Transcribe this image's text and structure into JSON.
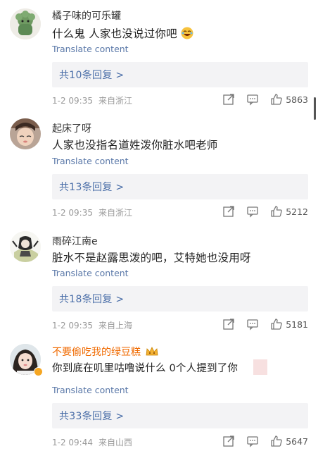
{
  "comments": [
    {
      "username": "橘子味的可乐罐",
      "text": "什么鬼 人家也没说过你吧",
      "translate": "Translate content",
      "replies": "共10条回复 >",
      "time": "1-2 09:35",
      "location": "来自浙江",
      "likes": "5863"
    },
    {
      "username": "起床了呀",
      "text": "人家也没指名道姓泼你脏水吧老师",
      "translate": "Translate content",
      "replies": "共13条回复 >",
      "time": "1-2 09:35",
      "location": "来自浙江",
      "likes": "5212"
    },
    {
      "username": "雨碎江南e",
      "text": "脏水不是赵露思泼的吧，艾特她也没用呀",
      "translate": "Translate content",
      "replies": "共18条回复 >",
      "time": "1-2 09:35",
      "location": "来自上海",
      "likes": "5181"
    },
    {
      "username": "不要偷吃我的绿豆糕",
      "text": "你到底在叽里咕噜说什么 0个人提到了你",
      "translate": "Translate content",
      "replies": "共33条回复 >",
      "time": "1-2 09:44",
      "location": "来自山西",
      "likes": "5647"
    }
  ],
  "icons": {
    "share": "share-icon",
    "comment": "comment-icon",
    "like": "thumbs-up-icon"
  },
  "colors": {
    "link": "#5a78a8",
    "replies": "#4a6ea8",
    "vip_name": "#f06a00"
  }
}
